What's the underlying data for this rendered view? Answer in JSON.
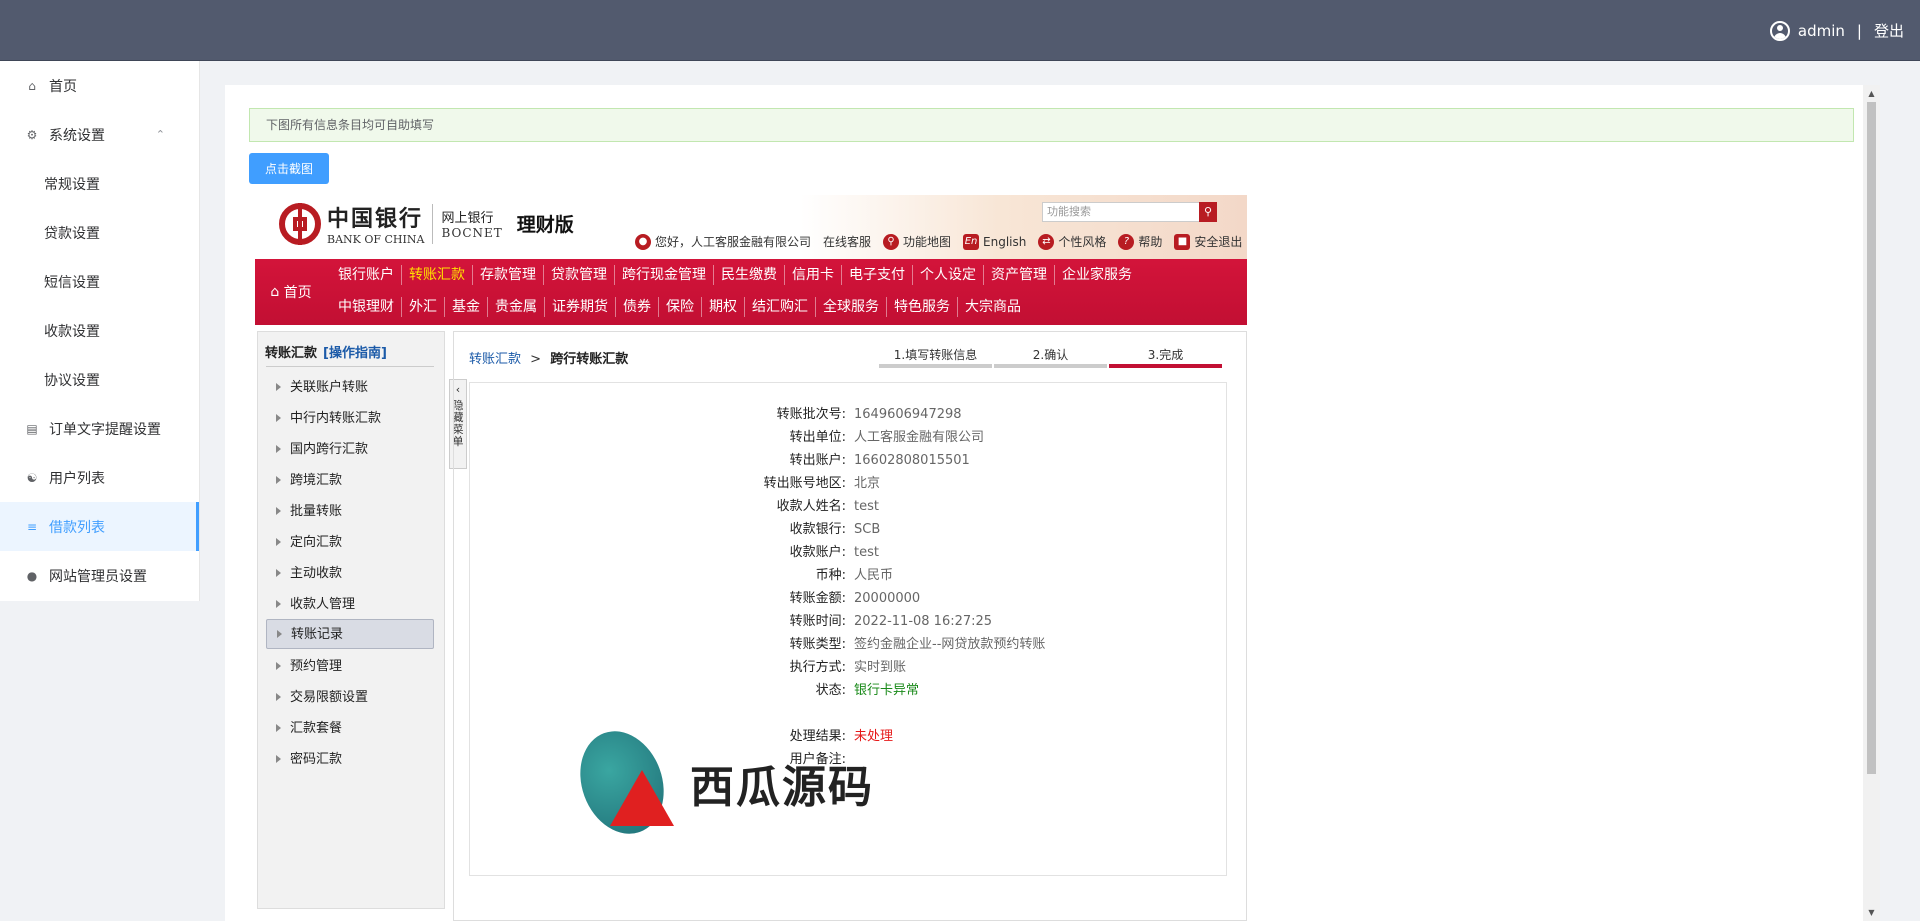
{
  "header": {
    "username": "admin",
    "separator": "|",
    "logout": "登出"
  },
  "sidebar": {
    "items": [
      {
        "label": "首页",
        "icon": "home-icon"
      },
      {
        "label": "系统设置",
        "icon": "gear-icon",
        "expanded": true
      },
      {
        "label": "常规设置",
        "sub": true
      },
      {
        "label": "贷款设置",
        "sub": true
      },
      {
        "label": "短信设置",
        "sub": true
      },
      {
        "label": "收款设置",
        "sub": true
      },
      {
        "label": "协议设置",
        "sub": true
      },
      {
        "label": "订单文字提醒设置",
        "icon": "book-icon"
      },
      {
        "label": "用户列表",
        "icon": "users-icon"
      },
      {
        "label": "借款列表",
        "icon": "list-icon",
        "active": true
      },
      {
        "label": "网站管理员设置",
        "icon": "user-icon"
      }
    ]
  },
  "content": {
    "notice": "下图所有信息条目均可自助填写",
    "screenshot_button": "点击截图"
  },
  "boc": {
    "logo_cn": "中国银行",
    "logo_en": "BANK OF CHINA",
    "net_cn": "网上银行",
    "net_en": "BOCNET",
    "edition": "理财版",
    "search_placeholder": "功能搜索",
    "greeting": "您好，人工客服金融有限公司",
    "tools": [
      "在线客服",
      "功能地图",
      "English",
      "个性风格",
      "帮助",
      "安全退出"
    ],
    "home": "首页",
    "nav_row1": [
      "银行账户",
      "转账汇款",
      "存款管理",
      "贷款管理",
      "跨行现金管理",
      "民生缴费",
      "信用卡",
      "电子支付",
      "个人设定",
      "资产管理",
      "企业家服务"
    ],
    "nav_row2": [
      "中银理财",
      "外汇",
      "基金",
      "贵金属",
      "证券期货",
      "债券",
      "保险",
      "期权",
      "结汇购汇",
      "全球服务",
      "特色服务",
      "大宗商品"
    ],
    "menu_title": "转账汇款",
    "menu_guide": "[操作指南]",
    "menu_items": [
      "关联账户转账",
      "中行内转账汇款",
      "国内跨行汇款",
      "跨境汇款",
      "批量转账",
      "定向汇款",
      "主动收款",
      "收款人管理",
      "转账记录",
      "预约管理",
      "交易限额设置",
      "汇款套餐",
      "密码汇款"
    ],
    "menu_selected": "转账记录",
    "hide_menu": "隐藏菜单",
    "crumb_1": "转账汇款",
    "crumb_sep": ">",
    "crumb_2": "跨行转账汇款",
    "steps": [
      "1.填写转账信息",
      "2.确认",
      "3.完成"
    ],
    "fields": [
      {
        "k": "转账批次号:",
        "v": "1649606947298"
      },
      {
        "k": "转出单位:",
        "v": "人工客服金融有限公司"
      },
      {
        "k": "转出账户:",
        "v": "16602808015501"
      },
      {
        "k": "转出账号地区:",
        "v": "北京"
      },
      {
        "k": "收款人姓名:",
        "v": "test"
      },
      {
        "k": "收款银行:",
        "v": "SCB"
      },
      {
        "k": "收款账户:",
        "v": "test"
      },
      {
        "k": "币种:",
        "v": "人民币"
      },
      {
        "k": "转账金额:",
        "v": "20000000"
      },
      {
        "k": "转账时间:",
        "v": "2022-11-08 16:27:25"
      },
      {
        "k": "转账类型:",
        "v": "签约金融企业--网贷放款预约转账"
      },
      {
        "k": "执行方式:",
        "v": "实时到账"
      },
      {
        "k": "状态:",
        "v": "银行卡异常"
      },
      {
        "k": "",
        "v": ""
      },
      {
        "k": "处理结果:",
        "v": "未处理"
      },
      {
        "k": "用户备注:",
        "v": ""
      }
    ]
  },
  "watermark": "西瓜源码",
  "colors": {
    "accent": "#409eff",
    "boc_red": "#c20f33",
    "topbar": "#525a6e",
    "status_green": "#1a8a1a",
    "status_red": "#e61a1a"
  }
}
